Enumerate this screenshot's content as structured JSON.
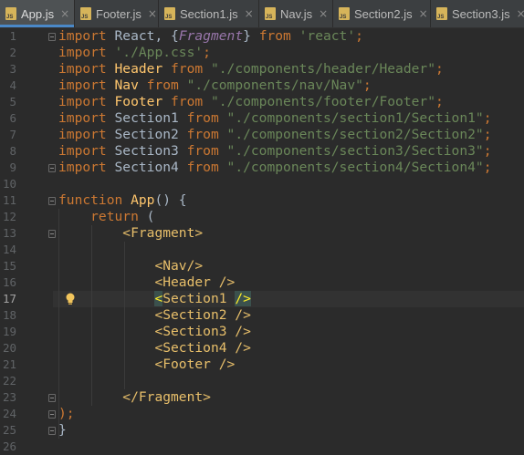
{
  "tabs": [
    {
      "label": "App.js",
      "active": true
    },
    {
      "label": "Footer.js",
      "active": false
    },
    {
      "label": "Section1.js",
      "active": false
    },
    {
      "label": "Nav.js",
      "active": false
    },
    {
      "label": "Section2.js",
      "active": false
    },
    {
      "label": "Section3.js",
      "active": false
    }
  ],
  "close_glyph": "×",
  "editor": {
    "current_line": 17,
    "lines": [
      {
        "n": "1",
        "tokens": [
          {
            "t": "import ",
            "c": "kw"
          },
          {
            "t": "React, {",
            "c": ""
          },
          {
            "t": "Fragment",
            "c": "it"
          },
          {
            "t": "} ",
            "c": ""
          },
          {
            "t": "from ",
            "c": "kw"
          },
          {
            "t": "'react'",
            "c": "str"
          },
          {
            "t": ";",
            "c": "kw"
          }
        ]
      },
      {
        "n": "2",
        "tokens": [
          {
            "t": "import ",
            "c": "kw"
          },
          {
            "t": "'./App.css'",
            "c": "str"
          },
          {
            "t": ";",
            "c": "kw"
          }
        ]
      },
      {
        "n": "3",
        "tokens": [
          {
            "t": "import ",
            "c": "kw"
          },
          {
            "t": "Header ",
            "c": "fn"
          },
          {
            "t": "from ",
            "c": "kw"
          },
          {
            "t": "\"./components/header/Header\"",
            "c": "str"
          },
          {
            "t": ";",
            "c": "kw"
          }
        ]
      },
      {
        "n": "4",
        "tokens": [
          {
            "t": "import ",
            "c": "kw"
          },
          {
            "t": "Nav ",
            "c": "fn"
          },
          {
            "t": "from ",
            "c": "kw"
          },
          {
            "t": "\"./components/nav/Nav\"",
            "c": "str"
          },
          {
            "t": ";",
            "c": "kw"
          }
        ]
      },
      {
        "n": "5",
        "tokens": [
          {
            "t": "import ",
            "c": "kw"
          },
          {
            "t": "Footer ",
            "c": "fn"
          },
          {
            "t": "from ",
            "c": "kw"
          },
          {
            "t": "\"./components/footer/Footer\"",
            "c": "str"
          },
          {
            "t": ";",
            "c": "kw"
          }
        ]
      },
      {
        "n": "6",
        "tokens": [
          {
            "t": "import ",
            "c": "kw"
          },
          {
            "t": "Section1 ",
            "c": ""
          },
          {
            "t": "from ",
            "c": "kw"
          },
          {
            "t": "\"./components/section1/Section1\"",
            "c": "str"
          },
          {
            "t": ";",
            "c": "kw"
          }
        ]
      },
      {
        "n": "7",
        "tokens": [
          {
            "t": "import ",
            "c": "kw"
          },
          {
            "t": "Section2 ",
            "c": ""
          },
          {
            "t": "from ",
            "c": "kw"
          },
          {
            "t": "\"./components/section2/Section2\"",
            "c": "str"
          },
          {
            "t": ";",
            "c": "kw"
          }
        ]
      },
      {
        "n": "8",
        "tokens": [
          {
            "t": "import ",
            "c": "kw"
          },
          {
            "t": "Section3 ",
            "c": ""
          },
          {
            "t": "from ",
            "c": "kw"
          },
          {
            "t": "\"./components/section3/Section3\"",
            "c": "str"
          },
          {
            "t": ";",
            "c": "kw"
          }
        ]
      },
      {
        "n": "9",
        "tokens": [
          {
            "t": "import ",
            "c": "kw"
          },
          {
            "t": "Section4 ",
            "c": ""
          },
          {
            "t": "from ",
            "c": "kw"
          },
          {
            "t": "\"./components/section4/Section4\"",
            "c": "str"
          },
          {
            "t": ";",
            "c": "kw"
          }
        ]
      },
      {
        "n": "10",
        "tokens": []
      },
      {
        "n": "11",
        "tokens": [
          {
            "t": "function ",
            "c": "kw"
          },
          {
            "t": "App",
            "c": "fn"
          },
          {
            "t": "() {",
            "c": ""
          }
        ]
      },
      {
        "n": "12",
        "tokens": [
          {
            "t": "    return ",
            "c": "kw"
          },
          {
            "t": "(",
            "c": ""
          }
        ]
      },
      {
        "n": "13",
        "tokens": [
          {
            "t": "        ",
            "c": ""
          },
          {
            "t": "<Fragment>",
            "c": "tag"
          }
        ]
      },
      {
        "n": "14",
        "tokens": []
      },
      {
        "n": "15",
        "tokens": [
          {
            "t": "            ",
            "c": ""
          },
          {
            "t": "<Nav/>",
            "c": "tag"
          }
        ]
      },
      {
        "n": "16",
        "tokens": [
          {
            "t": "            ",
            "c": ""
          },
          {
            "t": "<Header />",
            "c": "tag"
          }
        ]
      },
      {
        "n": "17",
        "tokens": [
          {
            "t": "            ",
            "c": ""
          },
          {
            "t": "<",
            "c": "brace-hl"
          },
          {
            "t": "Section1 ",
            "c": "tag"
          },
          {
            "t": "/>",
            "c": "brace-hl"
          }
        ]
      },
      {
        "n": "18",
        "tokens": [
          {
            "t": "            ",
            "c": ""
          },
          {
            "t": "<Section2 />",
            "c": "tag"
          }
        ]
      },
      {
        "n": "19",
        "tokens": [
          {
            "t": "            ",
            "c": ""
          },
          {
            "t": "<Section3 />",
            "c": "tag"
          }
        ]
      },
      {
        "n": "20",
        "tokens": [
          {
            "t": "            ",
            "c": ""
          },
          {
            "t": "<Section4 />",
            "c": "tag"
          }
        ]
      },
      {
        "n": "21",
        "tokens": [
          {
            "t": "            ",
            "c": ""
          },
          {
            "t": "<Footer />",
            "c": "tag"
          }
        ]
      },
      {
        "n": "22",
        "tokens": []
      },
      {
        "n": "23",
        "tokens": [
          {
            "t": "        ",
            "c": ""
          },
          {
            "t": "</Fragment>",
            "c": "tag"
          }
        ]
      },
      {
        "n": "24",
        "tokens": [
          {
            "t": ");",
            "c": "kw"
          }
        ]
      },
      {
        "n": "25",
        "tokens": [
          {
            "t": "}",
            "c": ""
          }
        ]
      },
      {
        "n": "26",
        "tokens": []
      }
    ],
    "fold_lines": [
      1,
      9,
      11,
      13,
      23,
      24,
      25
    ],
    "bulb_line": 17
  },
  "colors": {
    "background": "#2b2b2b",
    "keyword": "#cc7832",
    "string": "#6a8759",
    "function": "#ffc66d",
    "tag": "#e8bf6a",
    "active_tab_underline": "#4a88c7"
  }
}
